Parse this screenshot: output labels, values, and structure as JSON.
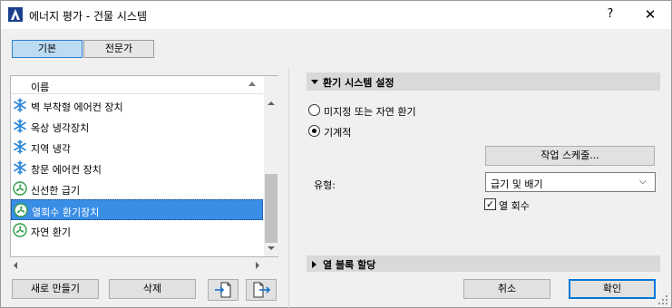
{
  "window": {
    "title": "에너지 평가 - 건물 시스템",
    "help_label": "?",
    "close_label": "✕"
  },
  "tabs": [
    {
      "label": "기본",
      "active": true
    },
    {
      "label": "전문가",
      "active": false
    }
  ],
  "list": {
    "header": "이름",
    "items": [
      {
        "label": "벽 부착형 에어컨 장치",
        "icon": "snowflake-icon",
        "selected": false
      },
      {
        "label": "옥상 냉각장치",
        "icon": "snowflake-icon",
        "selected": false
      },
      {
        "label": "지역 냉각",
        "icon": "snowflake-icon",
        "selected": false
      },
      {
        "label": "창문 에어컨 장치",
        "icon": "snowflake-icon",
        "selected": false
      },
      {
        "label": "신선한 급기",
        "icon": "fan-icon",
        "selected": false
      },
      {
        "label": "열회수 환기장치",
        "icon": "fan-icon",
        "selected": true
      },
      {
        "label": "자연 환기",
        "icon": "fan-icon",
        "selected": false
      }
    ]
  },
  "buttons": {
    "new": "새로 만들기",
    "delete": "삭제",
    "import_icon": "import-icon",
    "export_icon": "export-icon",
    "cancel": "취소",
    "ok": "확인"
  },
  "ventilation": {
    "section_title": "환기 시스템 설정",
    "radio_undefined": "미지정 또는 자연 환기",
    "radio_mechanical": "기계적",
    "selected_mode": "mechanical",
    "schedule_button": "작업 스케줄...",
    "type_label": "유형:",
    "type_value": "급기 및 배기",
    "heat_recovery_label": "열 회수",
    "heat_recovery_checked": true
  },
  "heat_block": {
    "section_title": "열 블록 할당"
  },
  "colors": {
    "selection": "#3a8ee6",
    "active_tab": "#bcdcf4",
    "snowflake": "#2b86d9",
    "fan": "#2e9e4a"
  }
}
